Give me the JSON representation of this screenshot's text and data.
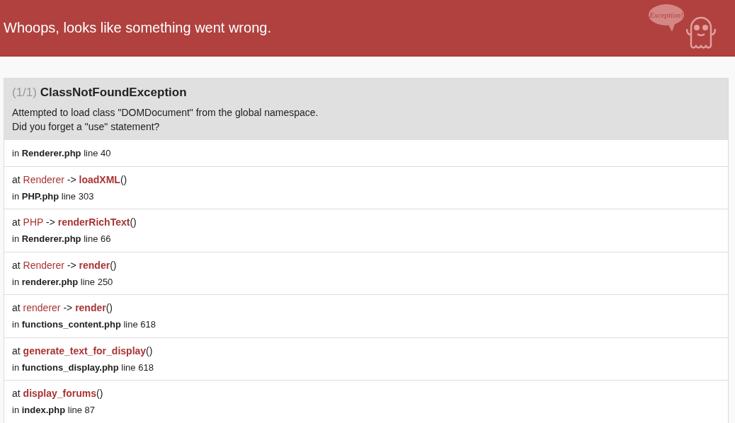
{
  "header": {
    "title": "Whoops, looks like something went wrong.",
    "logo_text": "Exception!"
  },
  "exception": {
    "count": "(1/1)",
    "name": "ClassNotFoundException",
    "message": [
      "Attempted to load class \"DOMDocument\" from the global namespace.",
      "Did you forget a \"use\" statement?"
    ]
  },
  "trace": [
    {
      "location": {
        "prefix": "in",
        "file": "Renderer.php",
        "line": "line 40"
      }
    },
    {
      "call": {
        "prefix": "at",
        "class": "Renderer",
        "operator": "->",
        "function": "loadXML",
        "args": "()"
      },
      "location": {
        "prefix": "in",
        "file": "PHP.php",
        "line": "line 303"
      }
    },
    {
      "call": {
        "prefix": "at",
        "class": "PHP",
        "operator": "->",
        "function": "renderRichText",
        "args": "()"
      },
      "location": {
        "prefix": "in",
        "file": "Renderer.php",
        "line": "line 66"
      }
    },
    {
      "call": {
        "prefix": "at",
        "class": "Renderer",
        "operator": "->",
        "function": "render",
        "args": "()"
      },
      "location": {
        "prefix": "in",
        "file": "renderer.php",
        "line": "line 250"
      }
    },
    {
      "call": {
        "prefix": "at",
        "class": "renderer",
        "operator": "->",
        "function": "render",
        "args": "()"
      },
      "location": {
        "prefix": "in",
        "file": "functions_content.php",
        "line": "line 618"
      }
    },
    {
      "call": {
        "prefix": "at",
        "function": "generate_text_for_display",
        "args": "()"
      },
      "location": {
        "prefix": "in",
        "file": "functions_display.php",
        "line": "line 618"
      }
    },
    {
      "call": {
        "prefix": "at",
        "function": "display_forums",
        "args": "()"
      },
      "location": {
        "prefix": "in",
        "file": "index.php",
        "line": "line 87"
      }
    }
  ]
}
